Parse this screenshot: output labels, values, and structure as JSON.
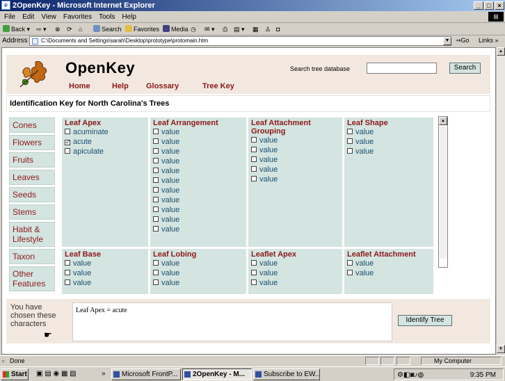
{
  "window": {
    "title": "2OpenKey - Microsoft Internet Explorer"
  },
  "menubar": {
    "items": [
      "File",
      "Edit",
      "View",
      "Favorites",
      "Tools",
      "Help"
    ]
  },
  "toolbar": {
    "back": "Back",
    "search": "Search",
    "favorites": "Favorites",
    "media": "Media"
  },
  "address": {
    "label": "Address",
    "url": "C:\\Documents and Settings\\sarah\\Desktop\\prototype\\protomain.htm",
    "go": "Go",
    "links": "Links"
  },
  "page": {
    "brand": "OpenKey",
    "nav": [
      "Home",
      "Help",
      "Glossary",
      "Tree Key"
    ],
    "search": {
      "label": "Search tree database",
      "button": "Search",
      "value": ""
    },
    "title": "Identification Key for North Carolina's Trees",
    "sidebar": [
      "Cones",
      "Flowers",
      "Fruits",
      "Leaves",
      "Seeds",
      "Stems",
      "Habit & Lifestyle",
      "Taxon",
      "Other Features"
    ],
    "characters": {
      "leaf_apex": {
        "title": "Leaf Apex",
        "options": [
          {
            "label": "acuminate",
            "checked": false
          },
          {
            "label": "acute",
            "checked": true
          },
          {
            "label": "apiculate",
            "checked": false
          }
        ]
      },
      "leaf_arrangement": {
        "title": "Leaf Arrangement",
        "options": [
          "value",
          "value",
          "value",
          "value",
          "value",
          "value",
          "value",
          "value",
          "value",
          "value",
          "value"
        ]
      },
      "leaf_attachment_grouping": {
        "title": "Leaf Attachment Grouping",
        "options": [
          "value",
          "value",
          "value",
          "value",
          "value"
        ]
      },
      "leaf_shape": {
        "title": "Leaf Shape",
        "options": [
          "value",
          "value",
          "value"
        ]
      },
      "leaf_base": {
        "title": "Leaf Base",
        "options": [
          "value",
          "value",
          "value"
        ]
      },
      "leaf_lobing": {
        "title": "Leaf Lobing",
        "options": [
          "value",
          "value",
          "value"
        ]
      },
      "leaflet_apex": {
        "title": "Leaflet Apex",
        "options": [
          "value",
          "value",
          "value"
        ]
      },
      "leaflet_attachment": {
        "title": "Leaflet Attachment",
        "options": [
          "value",
          "value"
        ]
      }
    },
    "chosen": {
      "label": "You have chosen these characters",
      "selection": "Leaf Apex = acute",
      "identify_button": "Identify Tree"
    }
  },
  "statusbar": {
    "text": "Done",
    "zone": "My Computer"
  },
  "taskbar": {
    "start": "Start",
    "tasks": [
      "Microsoft FrontP...",
      "2OpenKey - M...",
      "Subscribe to EW..."
    ],
    "clock": "9:35 PM"
  },
  "colors": {
    "header_bg": "#f3e8df",
    "cell_bg": "#d4e4e0",
    "accent": "#8b1a1a",
    "value_text": "#1a5070"
  }
}
